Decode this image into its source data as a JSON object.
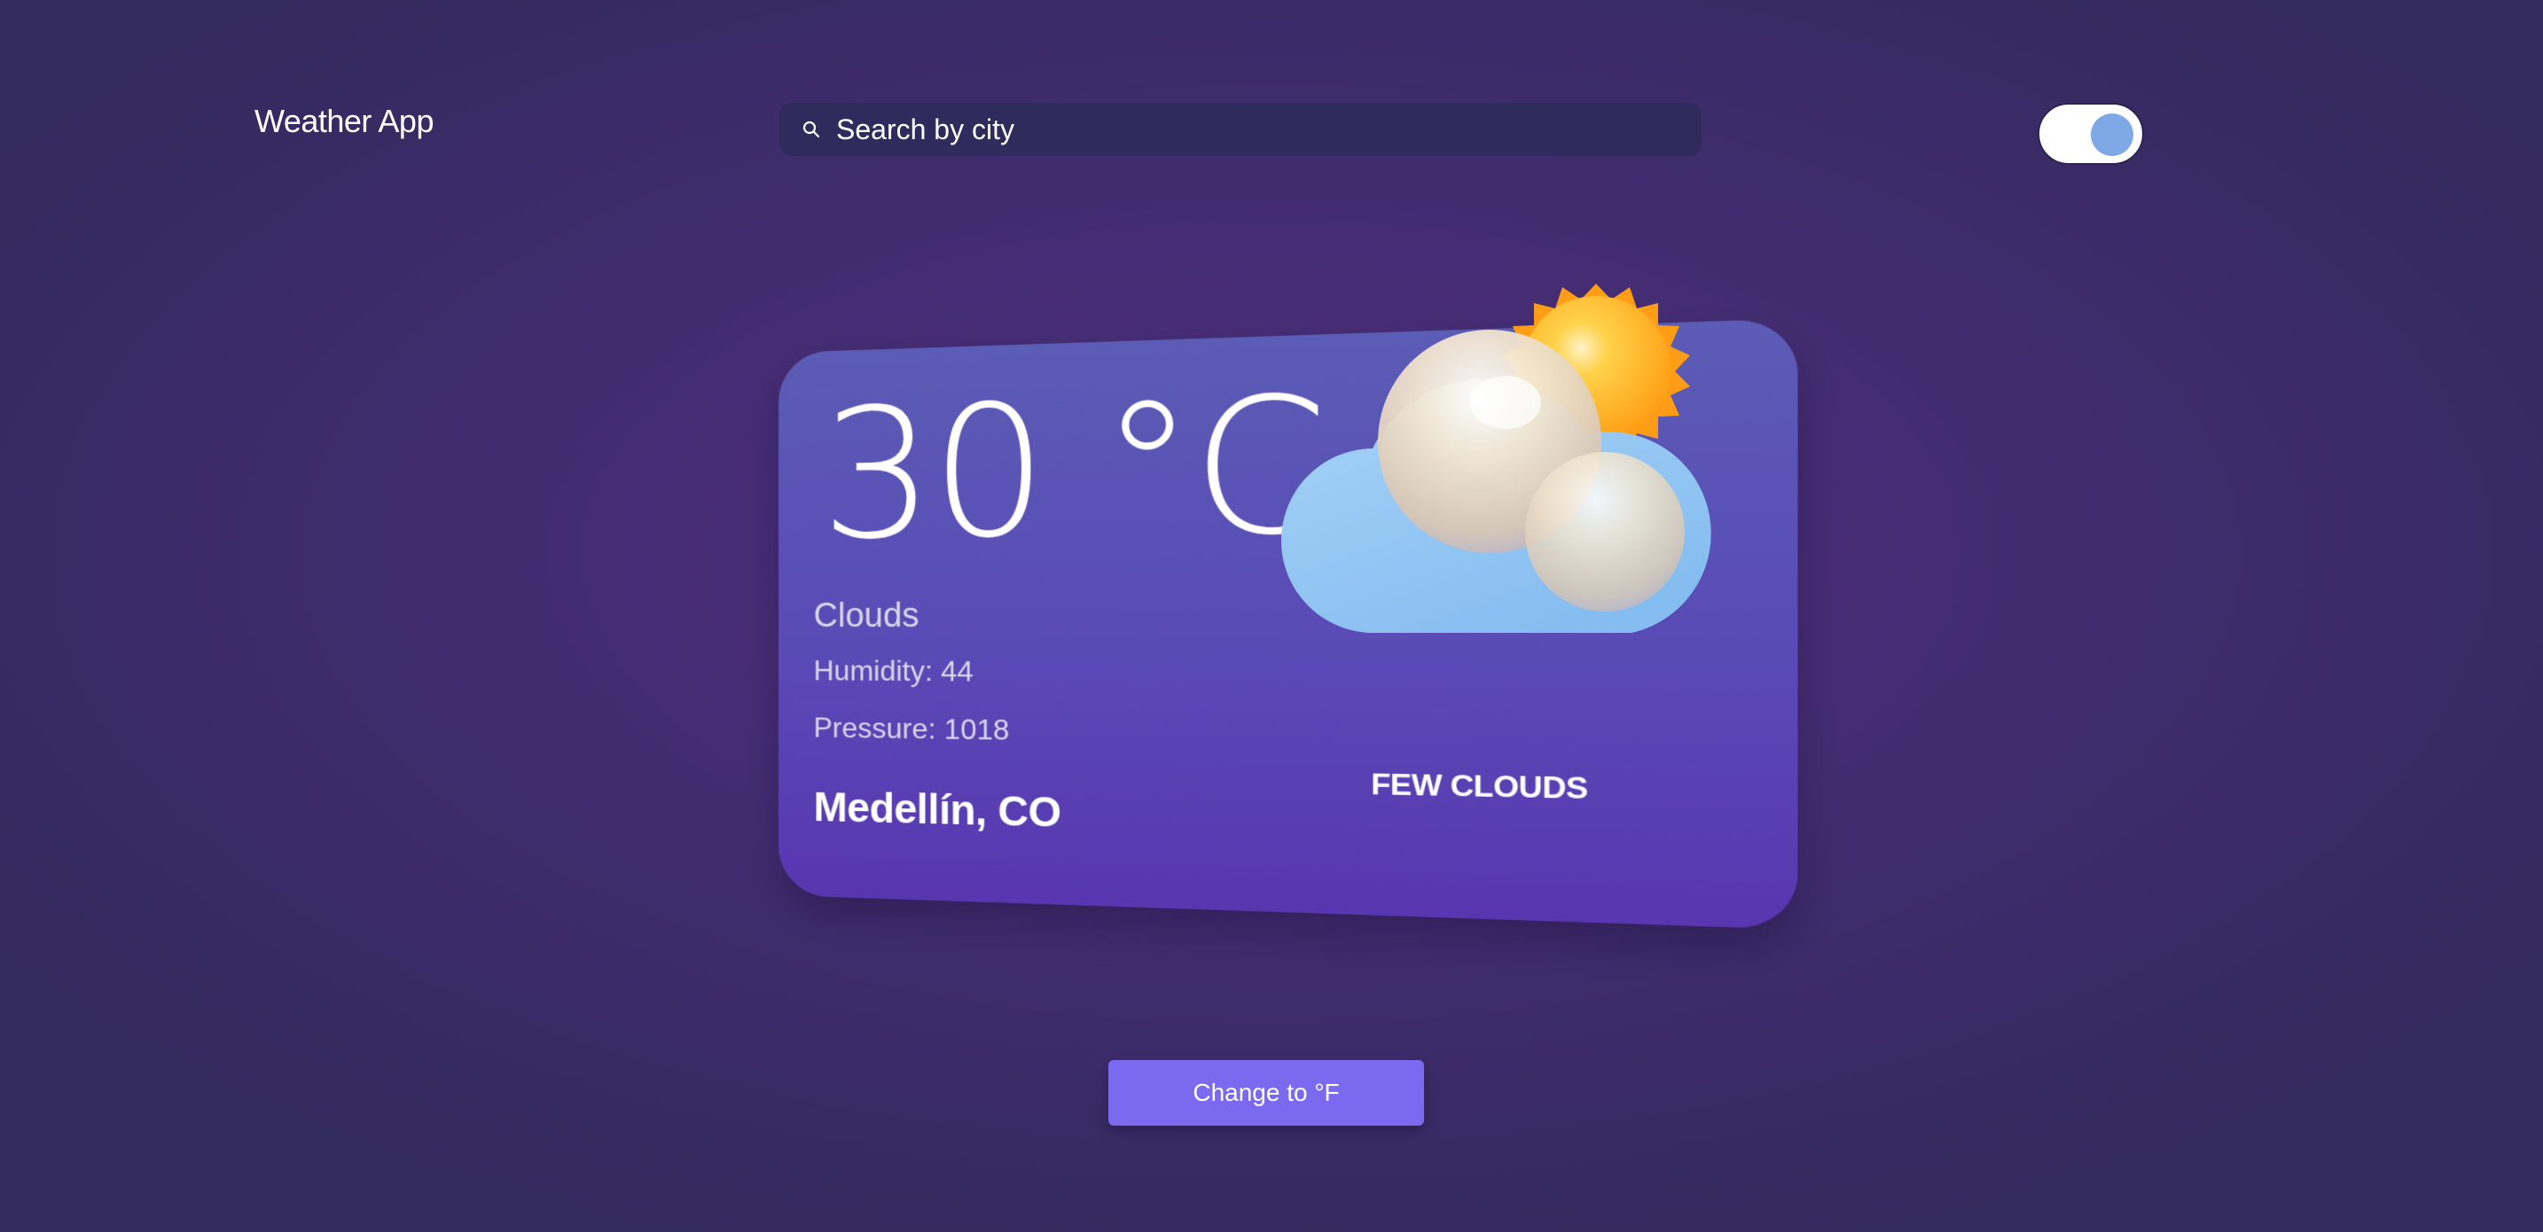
{
  "header": {
    "app_title": "Weather App",
    "search_placeholder": "Search by city",
    "search_value": "",
    "theme_toggle_on": true
  },
  "weather": {
    "temperature": "30 °C",
    "condition": "Clouds",
    "humidity": "Humidity: 44",
    "pressure": "Pressure: 1018",
    "city": "Medellín, CO",
    "description": "FEW CLOUDS",
    "icon": "few-clouds-icon"
  },
  "actions": {
    "unit_button_label": "Change to °F"
  },
  "colors": {
    "background": "#452d74",
    "search_bg": "#312a5c",
    "card_top": "#5b5cb5",
    "card_bottom": "#5836b0",
    "button": "#7b6af0",
    "toggle_knob": "#7fa8e6",
    "sun": "#ffb020",
    "cloud": "#8fc6f2"
  }
}
